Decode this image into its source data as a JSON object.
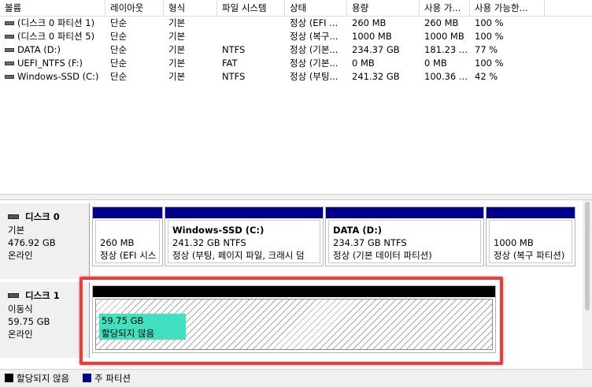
{
  "volume_table": {
    "columns": [
      "볼륨",
      "레이아웃",
      "형식",
      "파일 시스템",
      "상태",
      "용량",
      "사용 가...",
      "사용 가능한..."
    ],
    "rows": [
      [
        "(디스크 0 파티션 1)",
        "단순",
        "기본",
        "",
        "정상 (EFI ...",
        "260 MB",
        "260 MB",
        "100 %"
      ],
      [
        "(디스크 0 파티션 5)",
        "단순",
        "기본",
        "",
        "정상 (복구...",
        "1000 MB",
        "1000 MB",
        "100 %"
      ],
      [
        "DATA (D:)",
        "단순",
        "기본",
        "NTFS",
        "정상 (기본...",
        "234.37 GB",
        "181.23 ...",
        "77 %"
      ],
      [
        "UEFI_NTFS (F:)",
        "단순",
        "기본",
        "FAT",
        "정상 (기본...",
        "0 MB",
        "0 MB",
        "100 %"
      ],
      [
        "Windows-SSD (C:)",
        "단순",
        "기본",
        "NTFS",
        "정상 (부팅...",
        "241.32 GB",
        "100.36 ...",
        "42 %"
      ]
    ]
  },
  "disks": [
    {
      "title": "디스크 0",
      "type": "기본",
      "size": "476.92 GB",
      "status": "온라인",
      "partitions": [
        {
          "name": "",
          "size": "260 MB",
          "status": "정상 (EFI 시스"
        },
        {
          "name": "Windows-SSD  (C:)",
          "size": "241.32 GB NTFS",
          "status": "정상 (부팅, 페이지 파일, 크래시 덤"
        },
        {
          "name": "DATA  (D:)",
          "size": "234.37 GB NTFS",
          "status": "정상 (기본 데이터 파티션)"
        },
        {
          "name": "",
          "size": "1000 MB",
          "status": "정상 (복구 파티션)"
        }
      ]
    },
    {
      "title": "디스크 1",
      "type": "이동식",
      "size": "59.75 GB",
      "status": "온라인",
      "unallocated": {
        "size": "59.75 GB",
        "label": "할당되지 않음"
      }
    }
  ],
  "legend": [
    {
      "label": "할당되지 않음",
      "color": "#000000"
    },
    {
      "label": "주 파티션",
      "color": "#00008b"
    }
  ],
  "colors": {
    "primary_partition_bar": "#00008b",
    "unallocated_bar": "#000000",
    "selection": "#40e0c0",
    "highlight_border": "#ee3b3b"
  }
}
